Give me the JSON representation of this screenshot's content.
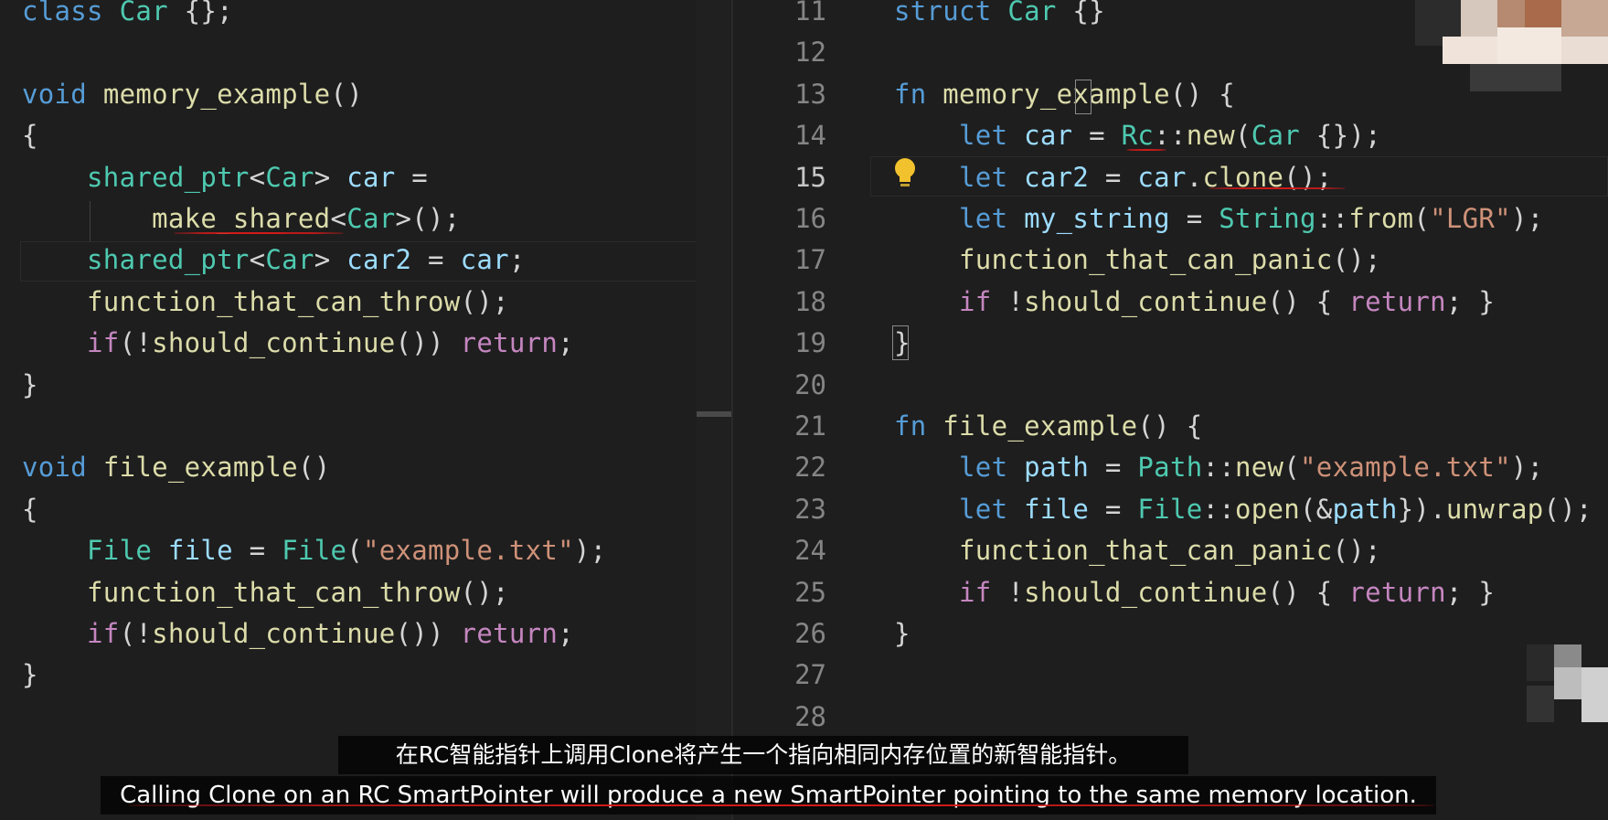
{
  "left_code": {
    "lines": [
      [
        [
          "kw",
          "class"
        ],
        [
          "plain",
          " "
        ],
        [
          "ty",
          "Car"
        ],
        [
          "plain",
          " {};"
        ]
      ],
      [],
      [
        [
          "kw",
          "void"
        ],
        [
          "plain",
          " "
        ],
        [
          "fn",
          "memory_example"
        ],
        [
          "plain",
          "()"
        ]
      ],
      [
        [
          "plain",
          "{"
        ]
      ],
      [
        [
          "plain",
          "    "
        ],
        [
          "ty",
          "shared_ptr"
        ],
        [
          "plain",
          "<"
        ],
        [
          "ty",
          "Car"
        ],
        [
          "plain",
          "> "
        ],
        [
          "var",
          "car"
        ],
        [
          "plain",
          " ="
        ]
      ],
      [
        [
          "plain",
          "        "
        ],
        [
          "fn",
          "make_shared"
        ],
        [
          "plain",
          "<"
        ],
        [
          "ty",
          "Car"
        ],
        [
          "plain",
          ">();"
        ]
      ],
      [
        [
          "plain",
          "    "
        ],
        [
          "ty",
          "shared_ptr"
        ],
        [
          "plain",
          "<"
        ],
        [
          "ty",
          "Car"
        ],
        [
          "plain",
          "> "
        ],
        [
          "var",
          "car2"
        ],
        [
          "plain",
          " = "
        ],
        [
          "var",
          "car"
        ],
        [
          "plain",
          ";"
        ]
      ],
      [
        [
          "plain",
          "    "
        ],
        [
          "fn",
          "function_that_can_throw"
        ],
        [
          "plain",
          "();"
        ]
      ],
      [
        [
          "plain",
          "    "
        ],
        [
          "ctl",
          "if"
        ],
        [
          "plain",
          "(!"
        ],
        [
          "fn",
          "should_continue"
        ],
        [
          "plain",
          "()) "
        ],
        [
          "ctl",
          "return"
        ],
        [
          "plain",
          ";"
        ]
      ],
      [
        [
          "plain",
          "}"
        ]
      ],
      [],
      [
        [
          "kw",
          "void"
        ],
        [
          "plain",
          " "
        ],
        [
          "fn",
          "file_example"
        ],
        [
          "plain",
          "()"
        ]
      ],
      [
        [
          "plain",
          "{"
        ]
      ],
      [
        [
          "plain",
          "    "
        ],
        [
          "ty",
          "File"
        ],
        [
          "plain",
          " "
        ],
        [
          "var",
          "file"
        ],
        [
          "plain",
          " = "
        ],
        [
          "ty",
          "File"
        ],
        [
          "plain",
          "("
        ],
        [
          "str",
          "\"example.txt\""
        ],
        [
          "plain",
          ");"
        ]
      ],
      [
        [
          "plain",
          "    "
        ],
        [
          "fn",
          "function_that_can_throw"
        ],
        [
          "plain",
          "();"
        ]
      ],
      [
        [
          "plain",
          "    "
        ],
        [
          "ctl",
          "if"
        ],
        [
          "plain",
          "(!"
        ],
        [
          "fn",
          "should_continue"
        ],
        [
          "plain",
          "()) "
        ],
        [
          "ctl",
          "return"
        ],
        [
          "plain",
          ";"
        ]
      ],
      [
        [
          "plain",
          "}"
        ]
      ]
    ]
  },
  "right_code": {
    "line_numbers": [
      "11",
      "12",
      "13",
      "14",
      "15",
      "16",
      "17",
      "18",
      "19",
      "20",
      "21",
      "22",
      "23",
      "24",
      "25",
      "26",
      "27",
      "28"
    ],
    "current_line": "15",
    "lines": [
      [
        [
          "kw",
          "struct"
        ],
        [
          "plain",
          " "
        ],
        [
          "ty",
          "Car"
        ],
        [
          "plain",
          " {}"
        ]
      ],
      [],
      [
        [
          "kw",
          "fn"
        ],
        [
          "plain",
          " "
        ],
        [
          "fn",
          "memory_example"
        ],
        [
          "plain",
          "() {"
        ]
      ],
      [
        [
          "plain",
          "    "
        ],
        [
          "kw",
          "let"
        ],
        [
          "plain",
          " "
        ],
        [
          "var",
          "car"
        ],
        [
          "plain",
          " = "
        ],
        [
          "ty",
          "Rc"
        ],
        [
          "plain",
          "::"
        ],
        [
          "fn",
          "new"
        ],
        [
          "plain",
          "("
        ],
        [
          "ty",
          "Car"
        ],
        [
          "plain",
          " {});"
        ]
      ],
      [
        [
          "plain",
          "    "
        ],
        [
          "kw",
          "let"
        ],
        [
          "plain",
          " "
        ],
        [
          "var",
          "car2"
        ],
        [
          "plain",
          " = "
        ],
        [
          "var",
          "car"
        ],
        [
          "plain",
          "."
        ],
        [
          "fn",
          "clone"
        ],
        [
          "plain",
          "();"
        ]
      ],
      [
        [
          "plain",
          "    "
        ],
        [
          "kw",
          "let"
        ],
        [
          "plain",
          " "
        ],
        [
          "var",
          "my_string"
        ],
        [
          "plain",
          " = "
        ],
        [
          "ty",
          "String"
        ],
        [
          "plain",
          "::"
        ],
        [
          "fn",
          "from"
        ],
        [
          "plain",
          "("
        ],
        [
          "str",
          "\"LGR\""
        ],
        [
          "plain",
          ");"
        ]
      ],
      [
        [
          "plain",
          "    "
        ],
        [
          "fn",
          "function_that_can_panic"
        ],
        [
          "plain",
          "();"
        ]
      ],
      [
        [
          "plain",
          "    "
        ],
        [
          "ctl",
          "if"
        ],
        [
          "plain",
          " !"
        ],
        [
          "fn",
          "should_continue"
        ],
        [
          "plain",
          "() { "
        ],
        [
          "ctl",
          "return"
        ],
        [
          "plain",
          "; }"
        ]
      ],
      [
        [
          "plain",
          "}"
        ]
      ],
      [],
      [
        [
          "kw",
          "fn"
        ],
        [
          "plain",
          " "
        ],
        [
          "fn",
          "file_example"
        ],
        [
          "plain",
          "() {"
        ]
      ],
      [
        [
          "plain",
          "    "
        ],
        [
          "kw",
          "let"
        ],
        [
          "plain",
          " "
        ],
        [
          "var",
          "path"
        ],
        [
          "plain",
          " = "
        ],
        [
          "ty",
          "Path"
        ],
        [
          "plain",
          "::"
        ],
        [
          "fn",
          "new"
        ],
        [
          "plain",
          "("
        ],
        [
          "str",
          "\"example.txt\""
        ],
        [
          "plain",
          ");"
        ]
      ],
      [
        [
          "plain",
          "    "
        ],
        [
          "kw",
          "let"
        ],
        [
          "plain",
          " "
        ],
        [
          "var",
          "file"
        ],
        [
          "plain",
          " = "
        ],
        [
          "ty",
          "File"
        ],
        [
          "plain",
          "::"
        ],
        [
          "fn",
          "open"
        ],
        [
          "plain",
          "(&"
        ],
        [
          "var",
          "path"
        ],
        [
          "plain",
          "})."
        ],
        [
          "fn",
          "unwrap"
        ],
        [
          "plain",
          "();"
        ]
      ],
      [
        [
          "plain",
          "    "
        ],
        [
          "fn",
          "function_that_can_panic"
        ],
        [
          "plain",
          "();"
        ]
      ],
      [
        [
          "plain",
          "    "
        ],
        [
          "ctl",
          "if"
        ],
        [
          "plain",
          " !"
        ],
        [
          "fn",
          "should_continue"
        ],
        [
          "plain",
          "() { "
        ],
        [
          "ctl",
          "return"
        ],
        [
          "plain",
          "; }"
        ]
      ],
      [
        [
          "plain",
          "}"
        ]
      ],
      [],
      []
    ]
  },
  "captions": {
    "chinese": "在RC智能指针上调用Clone将产生一个指向相同内存位置的新智能指针。",
    "english": "Calling Clone on an RC SmartPointer will produce a new SmartPointer pointing to the same memory location."
  },
  "icons": {
    "lightbulb": "lightbulb-icon"
  },
  "colors": {
    "background": "#1e1e1e",
    "keyword": "#569cd6",
    "type": "#4ec9b0",
    "function": "#dcdcaa",
    "variable": "#9cdcfe",
    "string": "#ce9178",
    "control": "#c586c0",
    "annotation_red": "#d11a1a"
  }
}
